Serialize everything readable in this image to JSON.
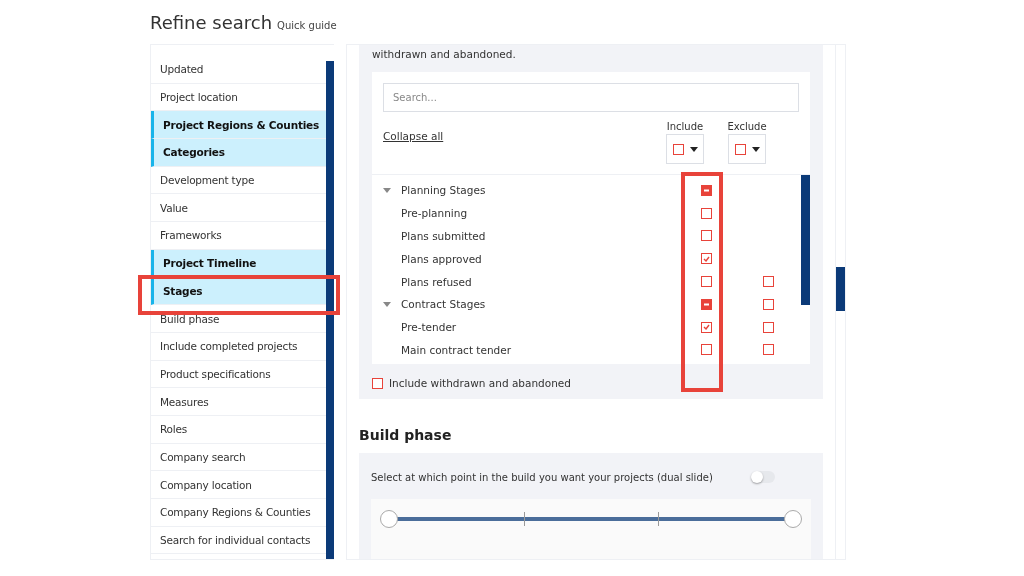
{
  "header": {
    "title": "Refine search",
    "guide_link": "Quick guide"
  },
  "sidebar": {
    "items": [
      {
        "label": "Updated",
        "kind": "item",
        "highlighted": false
      },
      {
        "label": "Project location",
        "kind": "item",
        "highlighted": false
      },
      {
        "label": "Project Regions & Counties",
        "kind": "section",
        "highlighted": false
      },
      {
        "label": "Categories",
        "kind": "section",
        "highlighted": false
      },
      {
        "label": "Development type",
        "kind": "item",
        "highlighted": false
      },
      {
        "label": "Value",
        "kind": "item",
        "highlighted": false
      },
      {
        "label": "Frameworks",
        "kind": "item",
        "highlighted": false
      },
      {
        "label": "Project Timeline",
        "kind": "section",
        "highlighted": false
      },
      {
        "label": "Stages",
        "kind": "section",
        "highlighted": true
      },
      {
        "label": "Build phase",
        "kind": "item",
        "highlighted": false
      },
      {
        "label": "Include completed projects",
        "kind": "item",
        "highlighted": false
      },
      {
        "label": "Product specifications",
        "kind": "item",
        "highlighted": false
      },
      {
        "label": "Measures",
        "kind": "item",
        "highlighted": false
      },
      {
        "label": "Roles",
        "kind": "item",
        "highlighted": false
      },
      {
        "label": "Company search",
        "kind": "item",
        "highlighted": false
      },
      {
        "label": "Company location",
        "kind": "item",
        "highlighted": false
      },
      {
        "label": "Company Regions & Counties",
        "kind": "item",
        "highlighted": false
      },
      {
        "label": "Search for individual contacts",
        "kind": "item",
        "highlighted": false
      }
    ]
  },
  "stages": {
    "intro": "withdrawn and abandoned.",
    "search": {
      "placeholder": "Search..."
    },
    "collapse_link": "Collapse all",
    "include_header": "Include",
    "exclude_header": "Exclude",
    "include_column_highlighted": true,
    "tree": [
      {
        "label": "Planning Stages",
        "expanded": true,
        "include_partial": true,
        "children": [
          {
            "label": "Pre-planning",
            "include_checked": false
          },
          {
            "label": "Plans submitted",
            "include_checked": false
          },
          {
            "label": "Plans approved",
            "include_checked": true
          },
          {
            "label": "Plans refused",
            "include_checked": false,
            "exclude_checked": false
          }
        ]
      },
      {
        "label": "Contract Stages",
        "expanded": true,
        "include_partial": true,
        "exclude_checked": false,
        "children": [
          {
            "label": "Pre-tender",
            "include_checked": true,
            "exclude_checked": false
          },
          {
            "label": "Main contract tender",
            "include_checked": false,
            "exclude_checked": false
          }
        ]
      }
    ],
    "withdrawn": {
      "label": "Include withdrawn and abandoned",
      "checked": false
    }
  },
  "build_phase": {
    "title": "Build phase",
    "prompt": "Select at which point in the build you want your projects (dual slide)",
    "toggle_on": false,
    "slider": {
      "low": {
        "level": 0
      },
      "high": {
        "level": 1
      }
    }
  }
}
